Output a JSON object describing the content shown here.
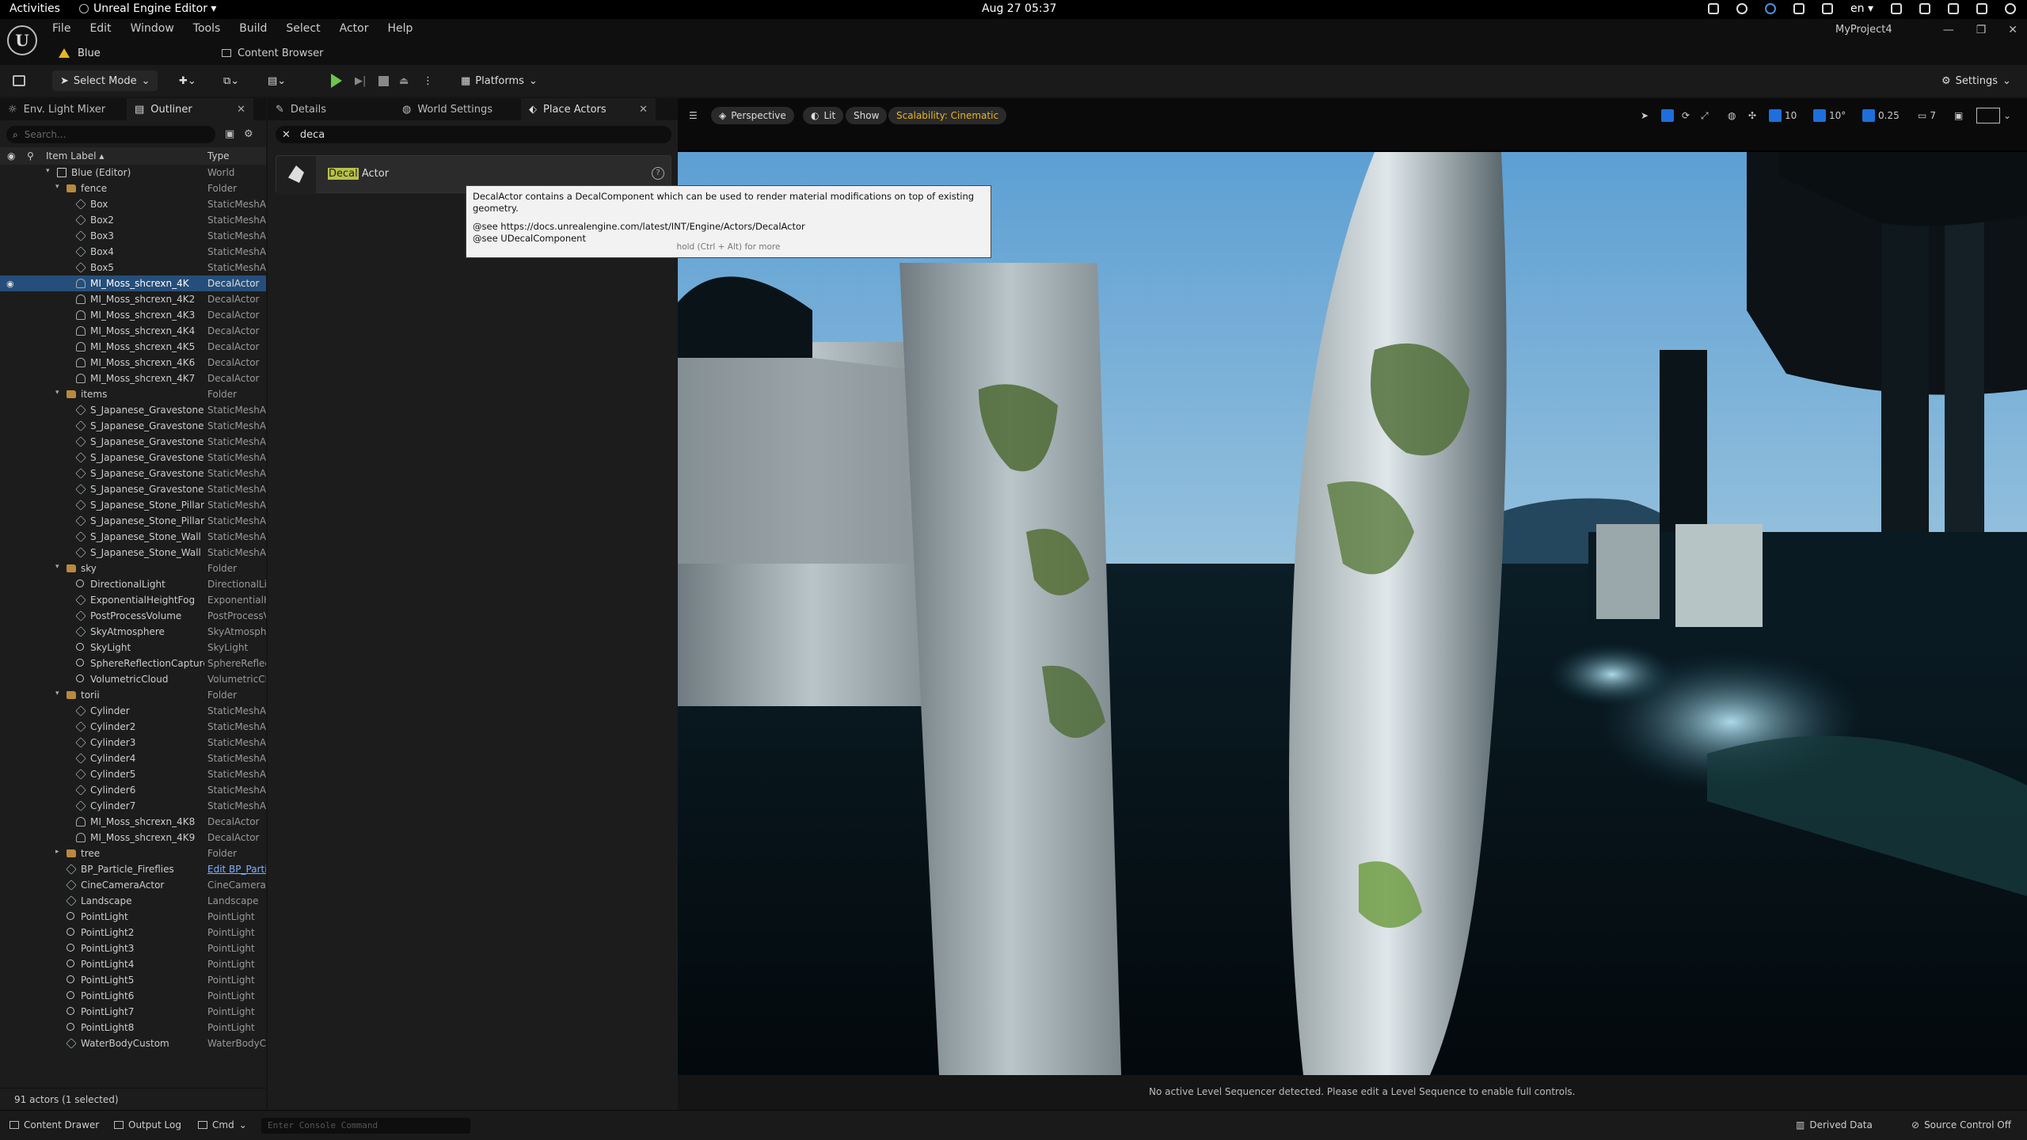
{
  "gnome": {
    "activities": "Activities",
    "app_name": "Unreal Engine Editor ▾",
    "clock": "Aug 27  05:37",
    "lang": "en ▾"
  },
  "editor": {
    "menu": [
      "File",
      "Edit",
      "Window",
      "Tools",
      "Build",
      "Select",
      "Actor",
      "Help"
    ],
    "level_tab": "Blue",
    "content_browser_tab": "Content Browser",
    "project": "MyProject4",
    "window_controls": [
      "—",
      "❐",
      "✕"
    ]
  },
  "toolbar": {
    "select_mode": "Select Mode",
    "platforms": "Platforms",
    "settings": "Settings"
  },
  "left_panel": {
    "tabs": [
      "Env. Light Mixer",
      "Outliner"
    ],
    "search_placeholder": "Search...",
    "col_label": "Item Label ▴",
    "col_type": "Type",
    "footer": "91 actors (1 selected)",
    "rows": [
      {
        "indent": 0,
        "arrow": "▾",
        "icon": "world",
        "label": "Blue (Editor)",
        "type": "World"
      },
      {
        "indent": 1,
        "arrow": "▾",
        "icon": "folder",
        "label": "fence",
        "type": "Folder"
      },
      {
        "indent": 2,
        "icon": "mesh",
        "label": "Box",
        "type": "StaticMeshActor"
      },
      {
        "indent": 2,
        "icon": "mesh",
        "label": "Box2",
        "type": "StaticMeshActor"
      },
      {
        "indent": 2,
        "icon": "mesh",
        "label": "Box3",
        "type": "StaticMeshActor"
      },
      {
        "indent": 2,
        "icon": "mesh",
        "label": "Box4",
        "type": "StaticMeshActor"
      },
      {
        "indent": 2,
        "icon": "mesh",
        "label": "Box5",
        "type": "StaticMeshActor"
      },
      {
        "indent": 2,
        "icon": "decal",
        "label": "MI_Moss_shcrexn_4K",
        "type": "DecalActor",
        "selected": true
      },
      {
        "indent": 2,
        "icon": "decal",
        "label": "MI_Moss_shcrexn_4K2",
        "type": "DecalActor"
      },
      {
        "indent": 2,
        "icon": "decal",
        "label": "MI_Moss_shcrexn_4K3",
        "type": "DecalActor"
      },
      {
        "indent": 2,
        "icon": "decal",
        "label": "MI_Moss_shcrexn_4K4",
        "type": "DecalActor"
      },
      {
        "indent": 2,
        "icon": "decal",
        "label": "MI_Moss_shcrexn_4K5",
        "type": "DecalActor"
      },
      {
        "indent": 2,
        "icon": "decal",
        "label": "MI_Moss_shcrexn_4K6",
        "type": "DecalActor"
      },
      {
        "indent": 2,
        "icon": "decal",
        "label": "MI_Moss_shcrexn_4K7",
        "type": "DecalActor"
      },
      {
        "indent": 1,
        "arrow": "▾",
        "icon": "folder",
        "label": "items",
        "type": "Folder"
      },
      {
        "indent": 2,
        "icon": "mesh",
        "label": "S_Japanese_Gravestone",
        "type": "StaticMeshActor"
      },
      {
        "indent": 2,
        "icon": "mesh",
        "label": "S_Japanese_Gravestone",
        "type": "StaticMeshActor"
      },
      {
        "indent": 2,
        "icon": "mesh",
        "label": "S_Japanese_Gravestone",
        "type": "StaticMeshActor"
      },
      {
        "indent": 2,
        "icon": "mesh",
        "label": "S_Japanese_Gravestone",
        "type": "StaticMeshActor"
      },
      {
        "indent": 2,
        "icon": "mesh",
        "label": "S_Japanese_Gravestone",
        "type": "StaticMeshActor"
      },
      {
        "indent": 2,
        "icon": "mesh",
        "label": "S_Japanese_Gravestone",
        "type": "StaticMeshActor"
      },
      {
        "indent": 2,
        "icon": "mesh",
        "label": "S_Japanese_Stone_Pillar",
        "type": "StaticMeshActor"
      },
      {
        "indent": 2,
        "icon": "mesh",
        "label": "S_Japanese_Stone_Pillar",
        "type": "StaticMeshActor"
      },
      {
        "indent": 2,
        "icon": "mesh",
        "label": "S_Japanese_Stone_Wall",
        "type": "StaticMeshActor"
      },
      {
        "indent": 2,
        "icon": "mesh",
        "label": "S_Japanese_Stone_Wall",
        "type": "StaticMeshActor"
      },
      {
        "indent": 1,
        "arrow": "▾",
        "icon": "folder",
        "label": "sky",
        "type": "Folder"
      },
      {
        "indent": 2,
        "icon": "light",
        "label": "DirectionalLight",
        "type": "DirectionalLight"
      },
      {
        "indent": 2,
        "icon": "mesh",
        "label": "ExponentialHeightFog",
        "type": "ExponentialHeightFog"
      },
      {
        "indent": 2,
        "icon": "mesh",
        "label": "PostProcessVolume",
        "type": "PostProcessVolume"
      },
      {
        "indent": 2,
        "icon": "mesh",
        "label": "SkyAtmosphere",
        "type": "SkyAtmosphere"
      },
      {
        "indent": 2,
        "icon": "light",
        "label": "SkyLight",
        "type": "SkyLight"
      },
      {
        "indent": 2,
        "icon": "light",
        "label": "SphereReflectionCapture",
        "type": "SphereReflectionCapture"
      },
      {
        "indent": 2,
        "icon": "light",
        "label": "VolumetricCloud",
        "type": "VolumetricCloud"
      },
      {
        "indent": 1,
        "arrow": "▾",
        "icon": "folder",
        "label": "torii",
        "type": "Folder"
      },
      {
        "indent": 2,
        "icon": "mesh",
        "label": "Cylinder",
        "type": "StaticMeshActor"
      },
      {
        "indent": 2,
        "icon": "mesh",
        "label": "Cylinder2",
        "type": "StaticMeshActor"
      },
      {
        "indent": 2,
        "icon": "mesh",
        "label": "Cylinder3",
        "type": "StaticMeshActor"
      },
      {
        "indent": 2,
        "icon": "mesh",
        "label": "Cylinder4",
        "type": "StaticMeshActor"
      },
      {
        "indent": 2,
        "icon": "mesh",
        "label": "Cylinder5",
        "type": "StaticMeshActor"
      },
      {
        "indent": 2,
        "icon": "mesh",
        "label": "Cylinder6",
        "type": "StaticMeshActor"
      },
      {
        "indent": 2,
        "icon": "mesh",
        "label": "Cylinder7",
        "type": "StaticMeshActor"
      },
      {
        "indent": 2,
        "icon": "decal",
        "label": "MI_Moss_shcrexn_4K8",
        "type": "DecalActor"
      },
      {
        "indent": 2,
        "icon": "decal",
        "label": "MI_Moss_shcrexn_4K9",
        "type": "DecalActor"
      },
      {
        "indent": 1,
        "arrow": "▸",
        "icon": "folder",
        "label": "tree",
        "type": "Folder"
      },
      {
        "indent": 1,
        "icon": "mesh",
        "label": "BP_Particle_Fireflies",
        "type": "Edit BP_Particle",
        "link": true
      },
      {
        "indent": 1,
        "icon": "mesh",
        "label": "CineCameraActor",
        "type": "CineCameraActor"
      },
      {
        "indent": 1,
        "icon": "mesh",
        "label": "Landscape",
        "type": "Landscape"
      },
      {
        "indent": 1,
        "icon": "light",
        "label": "PointLight",
        "type": "PointLight"
      },
      {
        "indent": 1,
        "icon": "light",
        "label": "PointLight2",
        "type": "PointLight"
      },
      {
        "indent": 1,
        "icon": "light",
        "label": "PointLight3",
        "type": "PointLight"
      },
      {
        "indent": 1,
        "icon": "light",
        "label": "PointLight4",
        "type": "PointLight"
      },
      {
        "indent": 1,
        "icon": "light",
        "label": "PointLight5",
        "type": "PointLight"
      },
      {
        "indent": 1,
        "icon": "light",
        "label": "PointLight6",
        "type": "PointLight"
      },
      {
        "indent": 1,
        "icon": "light",
        "label": "PointLight7",
        "type": "PointLight"
      },
      {
        "indent": 1,
        "icon": "light",
        "label": "PointLight8",
        "type": "PointLight"
      },
      {
        "indent": 1,
        "icon": "mesh",
        "label": "WaterBodyCustom",
        "type": "WaterBodyCustom"
      }
    ]
  },
  "mid_panel": {
    "tabs": [
      "Details",
      "World Settings",
      "Place Actors"
    ],
    "search_value": "deca",
    "result_match": "Decal",
    "result_rest": " Actor",
    "help": "?"
  },
  "tooltip": {
    "line1": "DecalActor contains a DecalComponent which can be used to render material modifications on top of existing geometry.",
    "line2": "@see https://docs.unrealengine.com/latest/INT/Engine/Actors/DecalActor",
    "line3": "@see UDecalComponent",
    "hint": "hold (Ctrl + Alt) for more"
  },
  "viewport": {
    "perspective": "Perspective",
    "lit": "Lit",
    "show": "Show",
    "scalability": "Scalability: Cinematic",
    "grid_snap": "10",
    "rot_snap": "10°",
    "scale_snap": "0.25",
    "cam_speed": "7",
    "footer_msg": "No active Level Sequencer detected. Please edit a Level Sequence to enable full controls."
  },
  "status_bar": {
    "content_drawer": "Content Drawer",
    "output_log": "Output Log",
    "cmd": "Cmd",
    "console_placeholder": "Enter Console Command",
    "derived_data": "Derived Data",
    "source_control": "Source Control Off"
  }
}
